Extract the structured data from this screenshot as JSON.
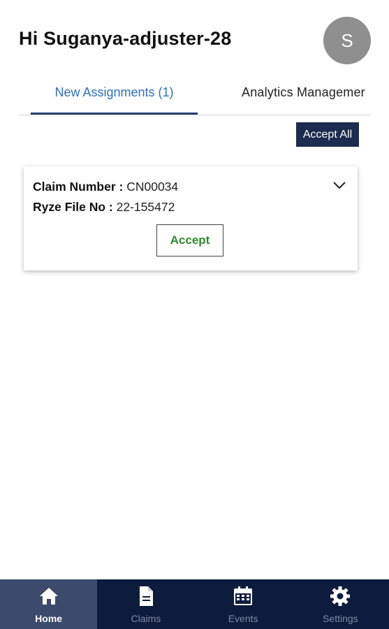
{
  "header": {
    "greeting": "Hi Suganya-adjuster-28",
    "avatar_initial": "S"
  },
  "tabs": [
    {
      "label": "New Assignments (1)",
      "active": true
    },
    {
      "label": "Analytics Managemer",
      "active": false
    }
  ],
  "actions": {
    "accept_all_label": "Accept All"
  },
  "assignment_card": {
    "claim_label": "Claim Number : ",
    "claim_value": "CN00034",
    "file_label": "Ryze File No : ",
    "file_value": "22-155472",
    "accept_label": "Accept"
  },
  "bottom_nav": [
    {
      "label": "Home",
      "icon": "home-icon",
      "active": true
    },
    {
      "label": "Claims",
      "icon": "document-icon",
      "active": false
    },
    {
      "label": "Events",
      "icon": "calendar-icon",
      "active": false
    },
    {
      "label": "Settings",
      "icon": "gear-icon",
      "active": false
    }
  ],
  "colors": {
    "tab_active_text": "#2f6fbd",
    "tab_indicator": "#2a3e70",
    "accept_all_bg": "#1c2b4f",
    "accept_text": "#2e8b2e",
    "nav_bg": "#0d1c3d",
    "nav_active_bg": "#3c4a6b",
    "avatar_bg": "#8f8f8f"
  }
}
